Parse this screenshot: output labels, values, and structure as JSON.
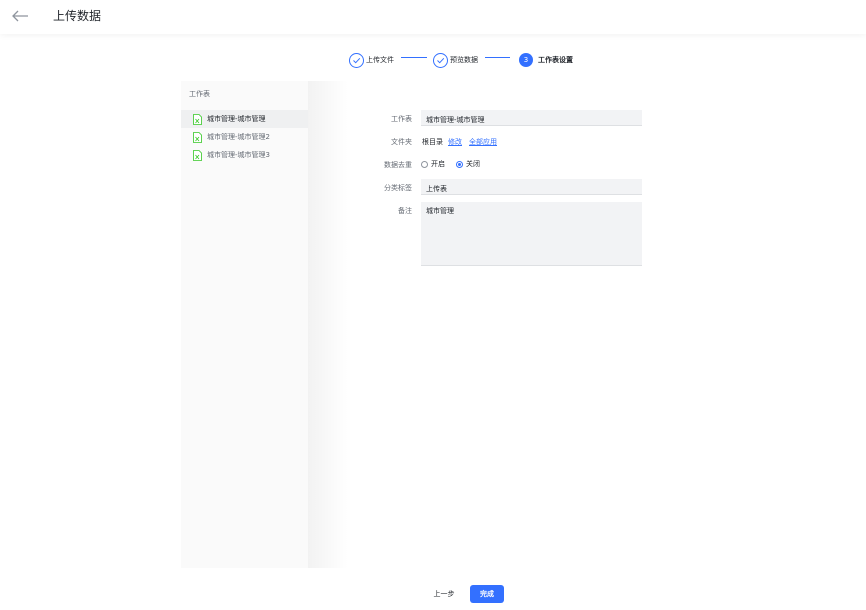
{
  "header": {
    "title": "上传数据",
    "back_icon": "arrow-left-icon"
  },
  "steps": [
    {
      "label": "上传文件",
      "state": "done"
    },
    {
      "label": "预览数据",
      "state": "done"
    },
    {
      "label": "工作表设置",
      "state": "current",
      "number": "3"
    }
  ],
  "sidebar": {
    "heading": "工作表",
    "items": [
      {
        "label": "城市管理-城市管理",
        "active": true
      },
      {
        "label": "城市管理-城市管理2",
        "active": false
      },
      {
        "label": "城市管理-城市管理3",
        "active": false
      }
    ]
  },
  "form": {
    "sheet_label": "工作表",
    "sheet_value": "城市管理-城市管理",
    "folder_label": "文件夹",
    "folder_value": "根目录",
    "folder_edit": "修改",
    "folder_apply_all": "全部应用",
    "dedupe_label": "数据去重",
    "dedupe_on": "开启",
    "dedupe_off": "关闭",
    "dedupe_selected": "关闭",
    "category_label": "分类标签",
    "category_value": "上传表",
    "note_label": "备注",
    "note_value": "城市管理"
  },
  "footer": {
    "prev_label": "上一步",
    "done_label": "完成"
  },
  "colors": {
    "accent": "#3370ff",
    "file_icon": "#34c724"
  }
}
